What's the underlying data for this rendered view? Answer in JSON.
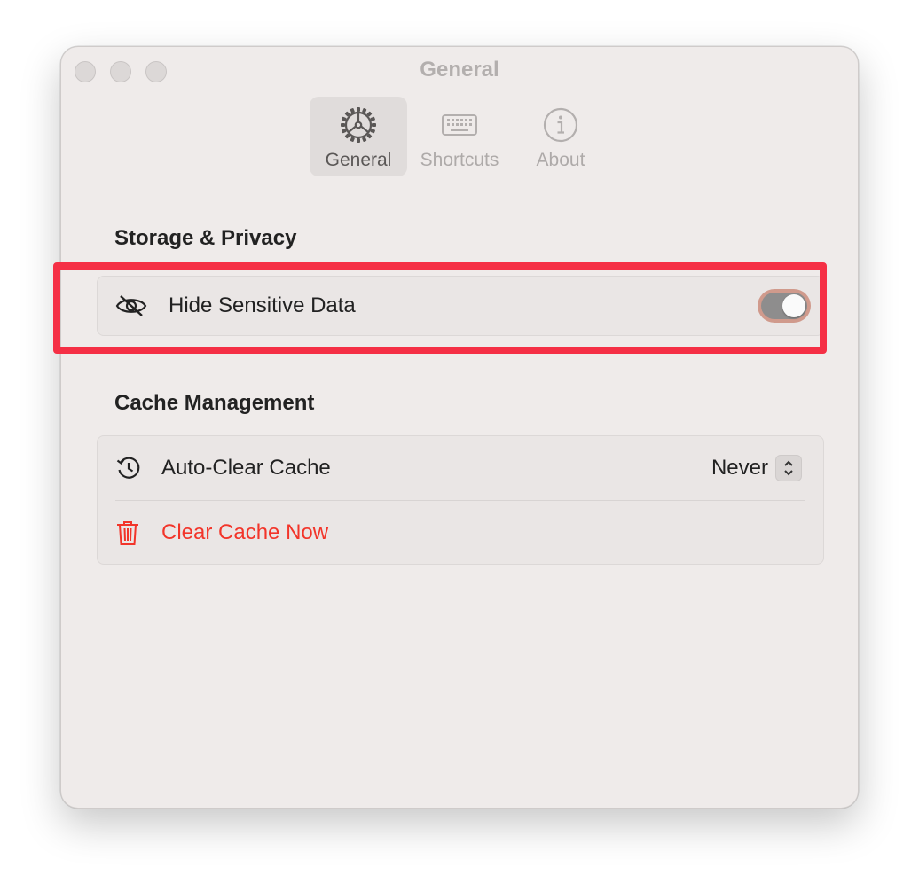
{
  "window": {
    "title": "General"
  },
  "toolbar": {
    "tabs": [
      {
        "label": "General",
        "icon": "gear-icon",
        "selected": true
      },
      {
        "label": "Shortcuts",
        "icon": "keyboard-icon",
        "selected": false
      },
      {
        "label": "About",
        "icon": "info-icon",
        "selected": false
      }
    ]
  },
  "storage": {
    "title": "Storage & Privacy",
    "hide_sensitive": {
      "label": "Hide Sensitive Data",
      "icon": "eye-slash-icon",
      "enabled": false
    }
  },
  "cache": {
    "title": "Cache Management",
    "auto_clear": {
      "label": "Auto-Clear Cache",
      "icon": "history-icon",
      "value": "Never"
    },
    "clear_now": {
      "label": "Clear Cache Now",
      "icon": "trash-icon"
    }
  },
  "colors": {
    "window_bg": "#efebea",
    "destructive": "#f2352a",
    "highlight": "#f52f45"
  }
}
